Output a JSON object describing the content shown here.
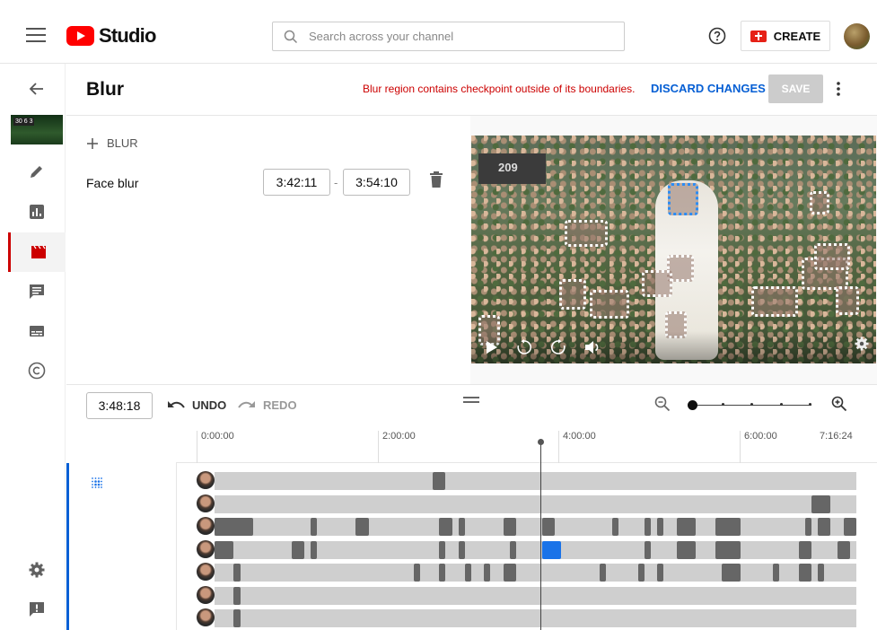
{
  "app": {
    "logo_text": "Studio",
    "brand_color": "#ff0000",
    "accent": "#065fd4"
  },
  "search": {
    "placeholder": "Search across your channel"
  },
  "header": {
    "create_label": "CREATE"
  },
  "thumbnail": {
    "score": "30 6 3"
  },
  "sidebar": {
    "items": [
      {
        "icon": "back-arrow-icon"
      },
      {
        "icon": "pencil-icon"
      },
      {
        "icon": "analytics-icon"
      },
      {
        "icon": "editor-clapper-icon",
        "active": true
      },
      {
        "icon": "comments-icon"
      },
      {
        "icon": "subtitles-icon"
      },
      {
        "icon": "copyright-icon"
      },
      {
        "icon": "settings-gear-icon"
      },
      {
        "icon": "feedback-icon"
      }
    ]
  },
  "editor": {
    "title": "Blur",
    "warning": "Blur region contains checkpoint outside of its boundaries.",
    "discard_label": "DISCARD CHANGES",
    "save_label": "SAVE",
    "add_blur_label": "BLUR",
    "blur_item": {
      "label": "Face blur",
      "start": "3:42:11",
      "end": "3:54:10"
    }
  },
  "video": {
    "scoreboard": "209"
  },
  "timeline": {
    "current_time": "3:48:18",
    "undo_label": "UNDO",
    "redo_label": "REDO",
    "ticks": [
      "0:00:00",
      "2:00:00",
      "4:00:00",
      "6:00:00",
      "7:16:24"
    ],
    "duration_seconds": 26184,
    "playhead_time": "3:48:18",
    "rows": [
      {
        "segments": [
          [
            34,
            36
          ]
        ]
      },
      {
        "segments": [
          [
            93,
            96
          ]
        ]
      },
      {
        "segments": [
          [
            0,
            6
          ],
          [
            15,
            16
          ],
          [
            22,
            24
          ],
          [
            35,
            37
          ],
          [
            38,
            39
          ],
          [
            45,
            47
          ],
          [
            51,
            53
          ],
          [
            62,
            63
          ],
          [
            67,
            68
          ],
          [
            69,
            70
          ],
          [
            72,
            75
          ],
          [
            78,
            82
          ],
          [
            92,
            93
          ],
          [
            94,
            96
          ],
          [
            98,
            100
          ]
        ]
      },
      {
        "segments": [
          [
            0,
            3
          ],
          [
            12,
            14
          ],
          [
            15,
            16
          ],
          [
            35,
            36
          ],
          [
            38,
            39
          ],
          [
            46,
            47
          ],
          [
            51,
            54,
            "sel"
          ],
          [
            67,
            68
          ],
          [
            72,
            75
          ],
          [
            78,
            82
          ],
          [
            91,
            93
          ],
          [
            97,
            99
          ]
        ]
      },
      {
        "segments": [
          [
            3,
            4
          ],
          [
            31,
            32
          ],
          [
            35,
            36
          ],
          [
            39,
            40
          ],
          [
            42,
            43
          ],
          [
            45,
            47
          ],
          [
            60,
            61
          ],
          [
            66,
            67
          ],
          [
            69,
            70
          ],
          [
            79,
            82
          ],
          [
            87,
            88
          ],
          [
            91,
            93
          ],
          [
            94,
            95
          ]
        ]
      },
      {
        "segments": [
          [
            3,
            4
          ]
        ]
      },
      {
        "segments": [
          [
            3,
            4
          ]
        ]
      }
    ]
  }
}
